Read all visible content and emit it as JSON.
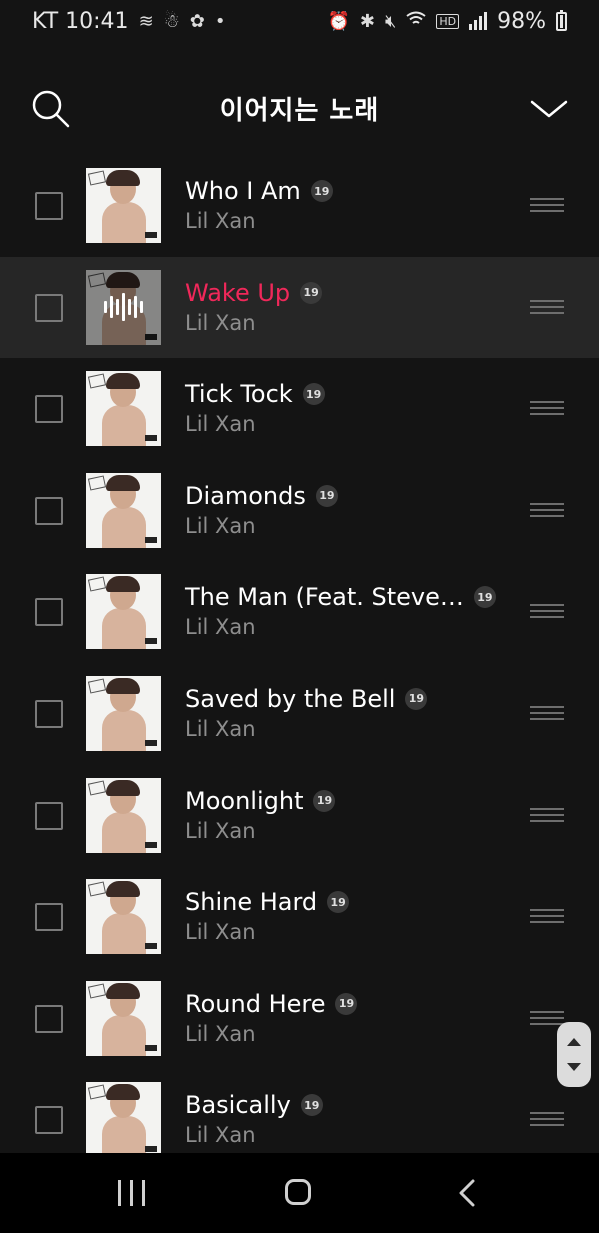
{
  "status_bar": {
    "carrier_time": "KT 10:41",
    "left_icons": [
      "signal-wave-icon",
      "snowman-icon",
      "flower-icon",
      "dot-icon"
    ],
    "right_icons": [
      "alarm-icon",
      "bluetooth-icon",
      "mute-icon",
      "wifi-icon",
      "hd-icon",
      "cell-signal-icon"
    ],
    "battery": "98%"
  },
  "header": {
    "title": "이어지는 노래",
    "search_icon": "search-icon",
    "collapse_icon": "chevron-down-icon"
  },
  "queue": [
    {
      "title": "Who I Am",
      "artist": "Lil Xan",
      "badge": "19",
      "playing": false
    },
    {
      "title": "Wake Up",
      "artist": "Lil Xan",
      "badge": "19",
      "playing": true
    },
    {
      "title": "Tick Tock",
      "artist": "Lil Xan",
      "badge": "19",
      "playing": false
    },
    {
      "title": "Diamonds",
      "artist": "Lil Xan",
      "badge": "19",
      "playing": false
    },
    {
      "title": "The Man (Feat. Steve…",
      "artist": "Lil Xan",
      "badge": "19",
      "playing": false
    },
    {
      "title": "Saved by the Bell",
      "artist": "Lil Xan",
      "badge": "19",
      "playing": false
    },
    {
      "title": "Moonlight",
      "artist": "Lil Xan",
      "badge": "19",
      "playing": false
    },
    {
      "title": "Shine Hard",
      "artist": "Lil Xan",
      "badge": "19",
      "playing": false
    },
    {
      "title": "Round Here",
      "artist": "Lil Xan",
      "badge": "19",
      "playing": false
    },
    {
      "title": "Basically",
      "artist": "Lil Xan",
      "badge": "19",
      "playing": false
    }
  ],
  "colors": {
    "background": "#141414",
    "active_row": "#262626",
    "accent": "#f0285a"
  },
  "nav_bar": {
    "icons": [
      "recents-icon",
      "home-icon",
      "back-icon"
    ]
  }
}
